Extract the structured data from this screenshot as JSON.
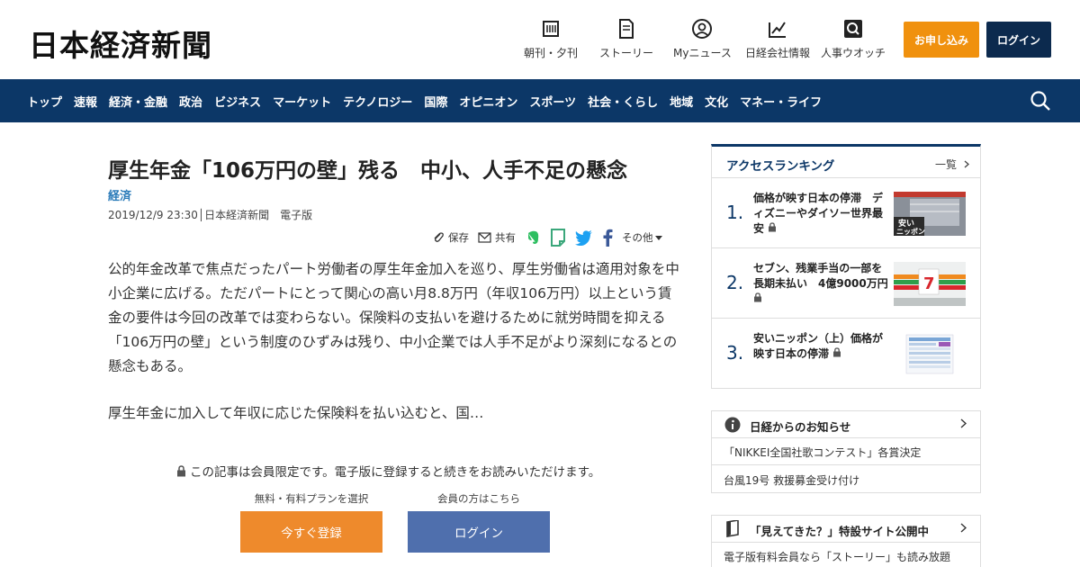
{
  "header": {
    "logo": "日本経済新聞",
    "nav": [
      {
        "label": "朝刊・夕刊",
        "icon": "newspaper-icon"
      },
      {
        "label": "ストーリー",
        "icon": "document-icon"
      },
      {
        "label": "Myニュース",
        "icon": "user-icon"
      },
      {
        "label": "日経会社情報",
        "icon": "chart-icon"
      },
      {
        "label": "人事ウオッチ",
        "icon": "magnifier-icon"
      }
    ],
    "subscribe": "お申し込み",
    "login": "ログイン"
  },
  "navbar": {
    "items": [
      "トップ",
      "速報",
      "経済・金融",
      "政治",
      "ビジネス",
      "マーケット",
      "テクノロジー",
      "国際",
      "オピニオン",
      "スポーツ",
      "社会・くらし",
      "地域",
      "文化",
      "マネー・ライフ"
    ]
  },
  "article": {
    "title": "厚生年金「106万円の壁」残る　中小、人手不足の懸念",
    "category": "経済",
    "meta": "2019/12/9 23:30│日本経済新聞　電子版",
    "share": {
      "save": "保存",
      "share": "共有",
      "more": "その他"
    },
    "body1": "公的年金改革で焦点だったパート労働者の厚生年金加入を巡り、厚生労働省は適用対象を中小企業に広げる。ただパートにとって関心の高い月8.8万円（年収106万円）以上という賃金の要件は今回の改革では変わらない。保険料の支払いを避けるために就労時間を抑える「106万円の壁」という制度のひずみは残り、中小企業では人手不足がより深刻になるとの懸念もある。",
    "body2": "厚生年金に加入して年収に応じた保険料を払い込むと、国…",
    "locked": "この記事は会員限定です。電子版に登録すると続きをお読みいただけます。",
    "register_label": "無料・有料プランを選択",
    "login_label": "会員の方はこちら",
    "register_button": "今すぐ登録",
    "login_button": "ログイン"
  },
  "ranking": {
    "title": "アクセスランキング",
    "more": "一覧",
    "items": [
      {
        "num": "1.",
        "text": "価格が映す日本の停滞　ディズニーやダイソー世界最安"
      },
      {
        "num": "2.",
        "text": "セブン、残業手当の一部を長期未払い　4億9000万円"
      },
      {
        "num": "3.",
        "text": "安いニッポン（上）価格が映す日本の停滞"
      }
    ]
  },
  "notice": {
    "title": "日経からのお知らせ",
    "items": [
      "「NIKKEI全国社歌コンテスト」各賞決定",
      "台風19号 救援募金受け付け"
    ]
  },
  "story": {
    "title": "「見えてきた？」特設サイト公開中",
    "text": "電子版有料会員なら「ストーリー」も読み放題"
  },
  "colors": {
    "navy": "#0c3767",
    "orange": "#f0910e",
    "link": "#2b7bb9"
  }
}
